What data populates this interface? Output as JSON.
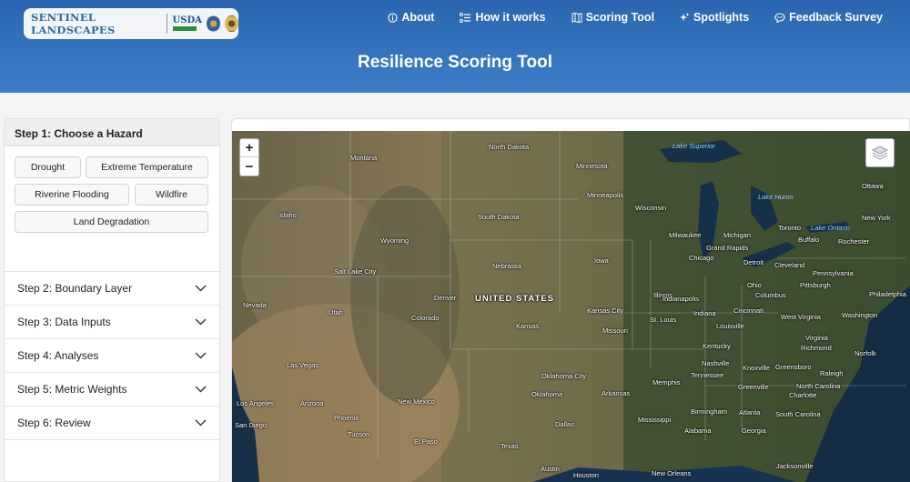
{
  "brand": {
    "name": "SENTINEL LANDSCAPES",
    "usda": "USDA"
  },
  "nav": [
    {
      "label": "About",
      "icon": "info-icon"
    },
    {
      "label": "How it works",
      "icon": "workflow-icon"
    },
    {
      "label": "Scoring Tool",
      "icon": "map-icon"
    },
    {
      "label": "Spotlights",
      "icon": "sparkle-icon"
    },
    {
      "label": "Feedback Survey",
      "icon": "chat-icon"
    }
  ],
  "page_title": "Resilience Scoring Tool",
  "step1": {
    "title": "Step 1: Choose a Hazard",
    "hazards": [
      "Drought",
      "Extreme Temperature",
      "Riverine Flooding",
      "Wildfire",
      "Land Degradation"
    ]
  },
  "steps": [
    "Step 2: Boundary Layer",
    "Step 3: Data Inputs",
    "Step 4: Analyses",
    "Step 5: Metric Weights",
    "Step 6: Review"
  ],
  "map": {
    "zoom_in": "+",
    "zoom_out": "−",
    "country_label": "UNITED STATES",
    "water_labels": [
      "Lake Superior",
      "Lake Huron",
      "Lake Ontario"
    ],
    "place_labels": [
      "North Dakota",
      "Montana",
      "Minnesota",
      "Minneapolis",
      "Wisconsin",
      "South Dakota",
      "Idaho",
      "Wyoming",
      "Nebraska",
      "Iowa",
      "Milwaukee",
      "Michigan",
      "Grand Rapids",
      "Detroit",
      "Chicago",
      "Toronto",
      "Buffalo",
      "Rochester",
      "Ottawa",
      "New York",
      "Cleveland",
      "Pennsylvania",
      "Pittsburgh",
      "Salt Lake City",
      "Nevada",
      "Utah",
      "Denver",
      "Colorado",
      "Kansas",
      "Kansas City",
      "Missouri",
      "St. Louis",
      "Illinois",
      "Indianapolis",
      "Indiana",
      "Ohio",
      "Columbus",
      "Cincinnati",
      "Louisville",
      "West Virginia",
      "Washington",
      "Virginia",
      "Richmond",
      "Kentucky",
      "Norfolk",
      "Las Vegas",
      "Los Angeles",
      "Arizona",
      "Phoenix",
      "Tucson",
      "San Diego",
      "New Mexico",
      "El Paso",
      "Oklahoma City",
      "Oklahoma",
      "Arkansas",
      "Memphis",
      "Nashville",
      "Tennessee",
      "Knoxville",
      "Greensboro",
      "Raleigh",
      "North Carolina",
      "Charlotte",
      "Greenville",
      "South Carolina",
      "Atlanta",
      "Birmingham",
      "Mississippi",
      "Alabama",
      "Georgia",
      "Dallas",
      "Texas",
      "Austin",
      "Houston",
      "New Orleans",
      "Jacksonville",
      "Philadelphia"
    ]
  },
  "colors": {
    "header": "#2f6db5",
    "accent": "#ffffff"
  }
}
